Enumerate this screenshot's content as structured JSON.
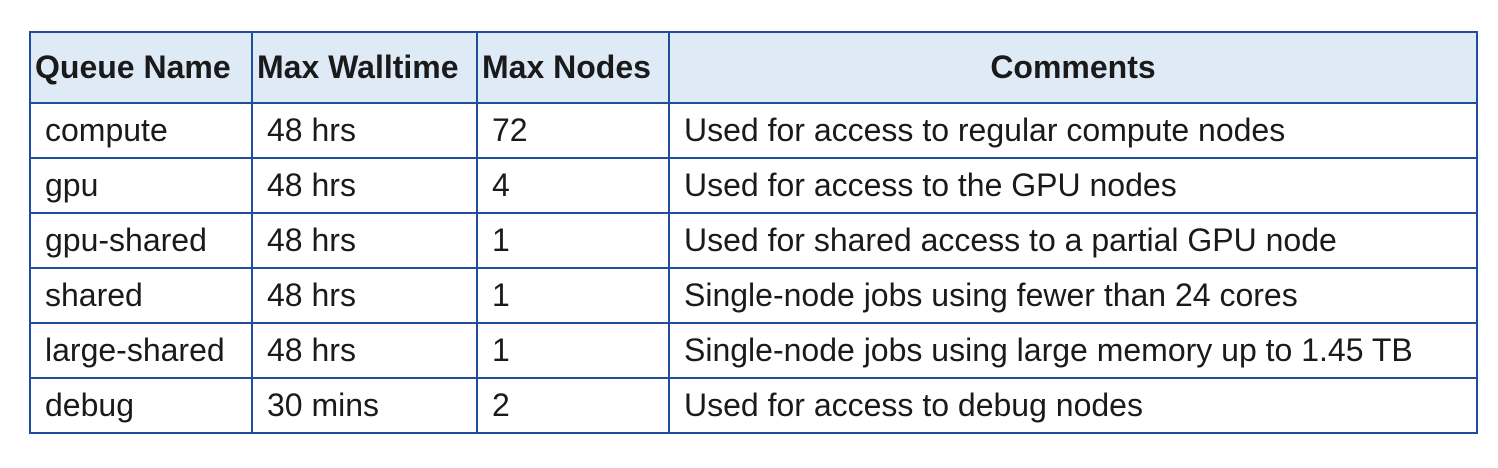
{
  "table": {
    "headers": [
      "Queue Name",
      "Max Walltime",
      "Max Nodes",
      "Comments"
    ],
    "rows": [
      [
        "compute",
        "48 hrs",
        "72",
        "Used for access to regular compute nodes"
      ],
      [
        "gpu",
        "48 hrs",
        "4",
        "Used for access to the GPU nodes"
      ],
      [
        "gpu-shared",
        "48 hrs",
        "1",
        "Used for shared access to a partial GPU node"
      ],
      [
        "shared",
        "48 hrs",
        "1",
        "Single-node jobs using fewer than 24 cores"
      ],
      [
        "large-shared",
        "48 hrs",
        "1",
        "Single-node jobs using large memory up to 1.45 TB"
      ],
      [
        "debug",
        "30 mins",
        "2",
        "Used for access to debug nodes"
      ]
    ]
  }
}
